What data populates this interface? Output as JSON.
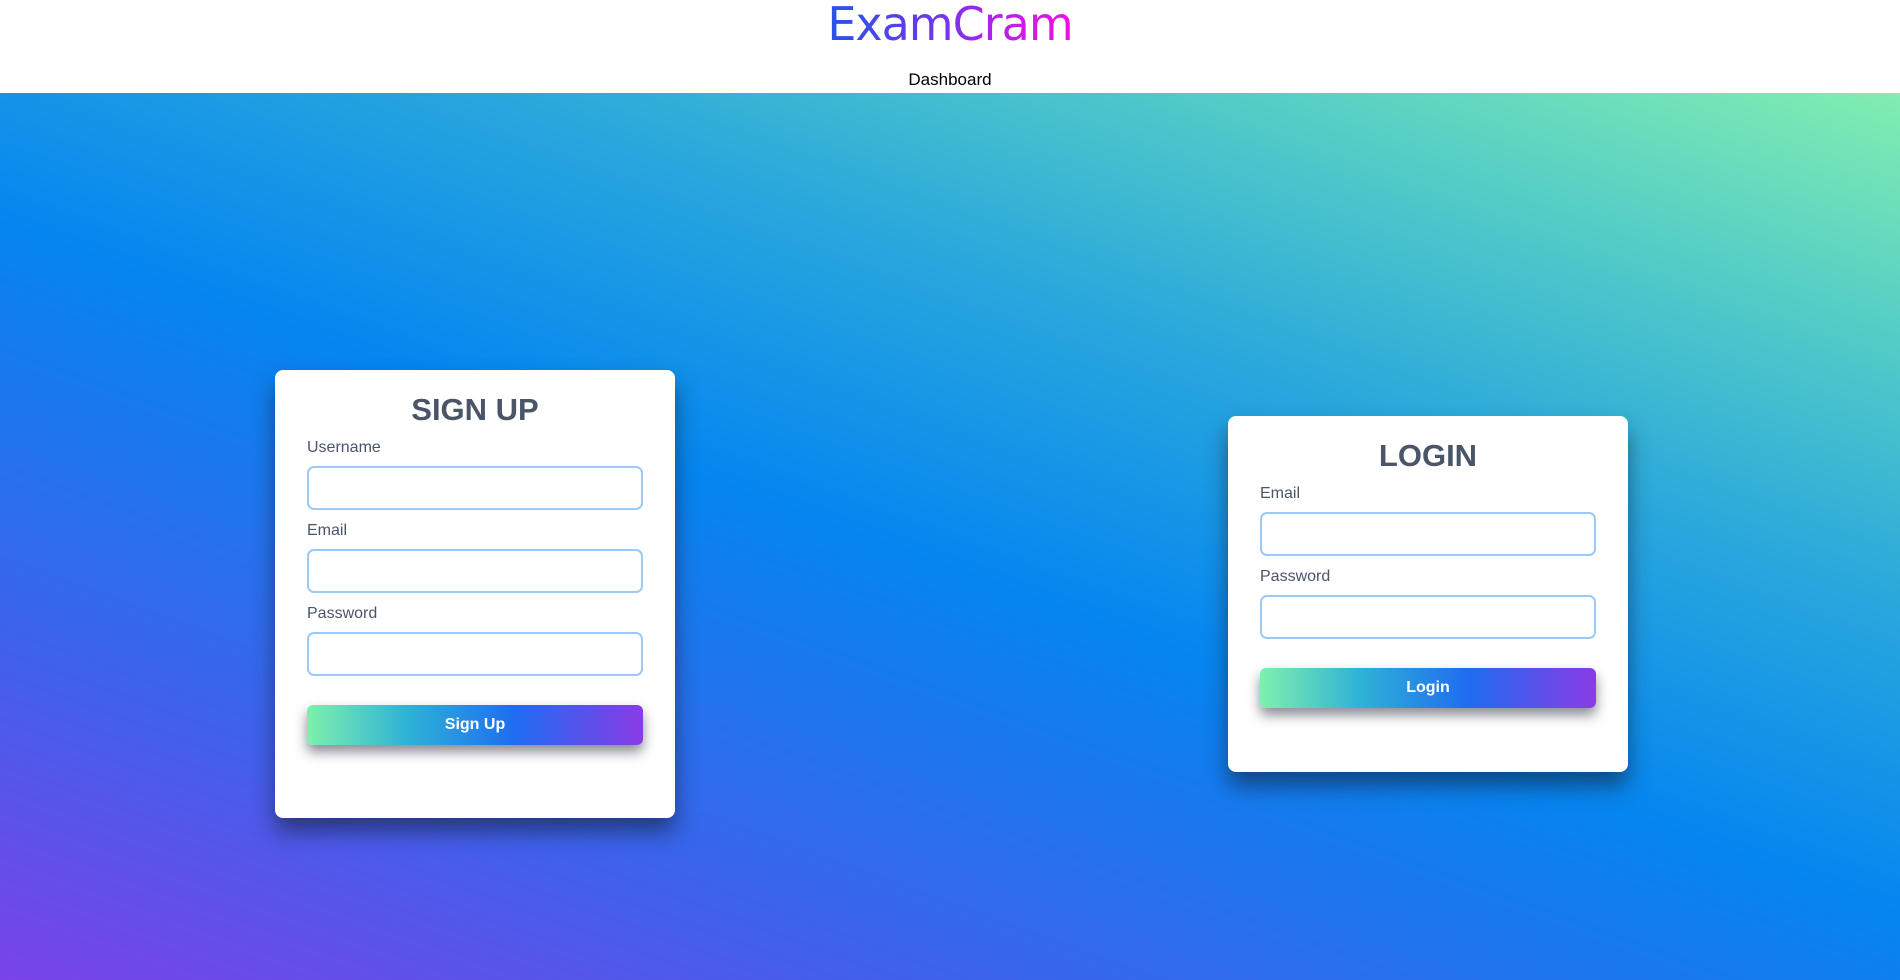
{
  "header": {
    "logo_text": "ExamCram",
    "nav": {
      "dashboard_label": "Dashboard"
    }
  },
  "signup": {
    "title": "SIGN UP",
    "username_label": "Username",
    "username_value": "",
    "email_label": "Email",
    "email_value": "",
    "password_label": "Password",
    "password_value": "",
    "submit_label": "Sign Up"
  },
  "login": {
    "title": "LOGIN",
    "email_label": "Email",
    "email_value": "",
    "password_label": "Password",
    "password_value": "",
    "submit_label": "Login"
  },
  "colors": {
    "logo_gradient": [
      "#2555e6",
      "#7036ec",
      "#c21ee6",
      "#f010de"
    ],
    "background_gradient": [
      "#7a43e8",
      "#0585f0",
      "#82eeb0"
    ],
    "button_gradient": [
      "#7ff0ad",
      "#2eb2d6",
      "#1f6cf0",
      "#8a3be6"
    ],
    "card_title": "#4a5568",
    "input_border": "#9cc9f5"
  }
}
